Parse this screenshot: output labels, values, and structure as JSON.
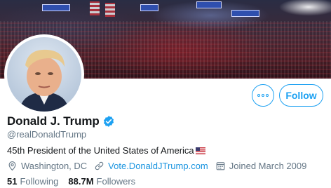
{
  "profile": {
    "display_name": "Donald J. Trump",
    "handle": "@realDonaldTrump",
    "verified": true,
    "bio": "45th President of the United States of America",
    "bio_emoji": "us-flag-icon",
    "location": "Washington, DC",
    "website": "Vote.DonaldJTrump.com",
    "joined": "Joined March 2009"
  },
  "stats": {
    "following_count": "51",
    "following_label": "Following",
    "followers_count": "88.7M",
    "followers_label": "Followers"
  },
  "actions": {
    "more_icon": "more-options-icon",
    "follow_label": "Follow"
  },
  "icons": {
    "location": "location-pin-icon",
    "website": "link-icon",
    "joined": "calendar-icon",
    "verified": "verified-badge-icon"
  },
  "colors": {
    "accent": "#1da1f2",
    "link": "#1b95e0",
    "secondary_text": "#657786",
    "primary_text": "#14171a"
  }
}
